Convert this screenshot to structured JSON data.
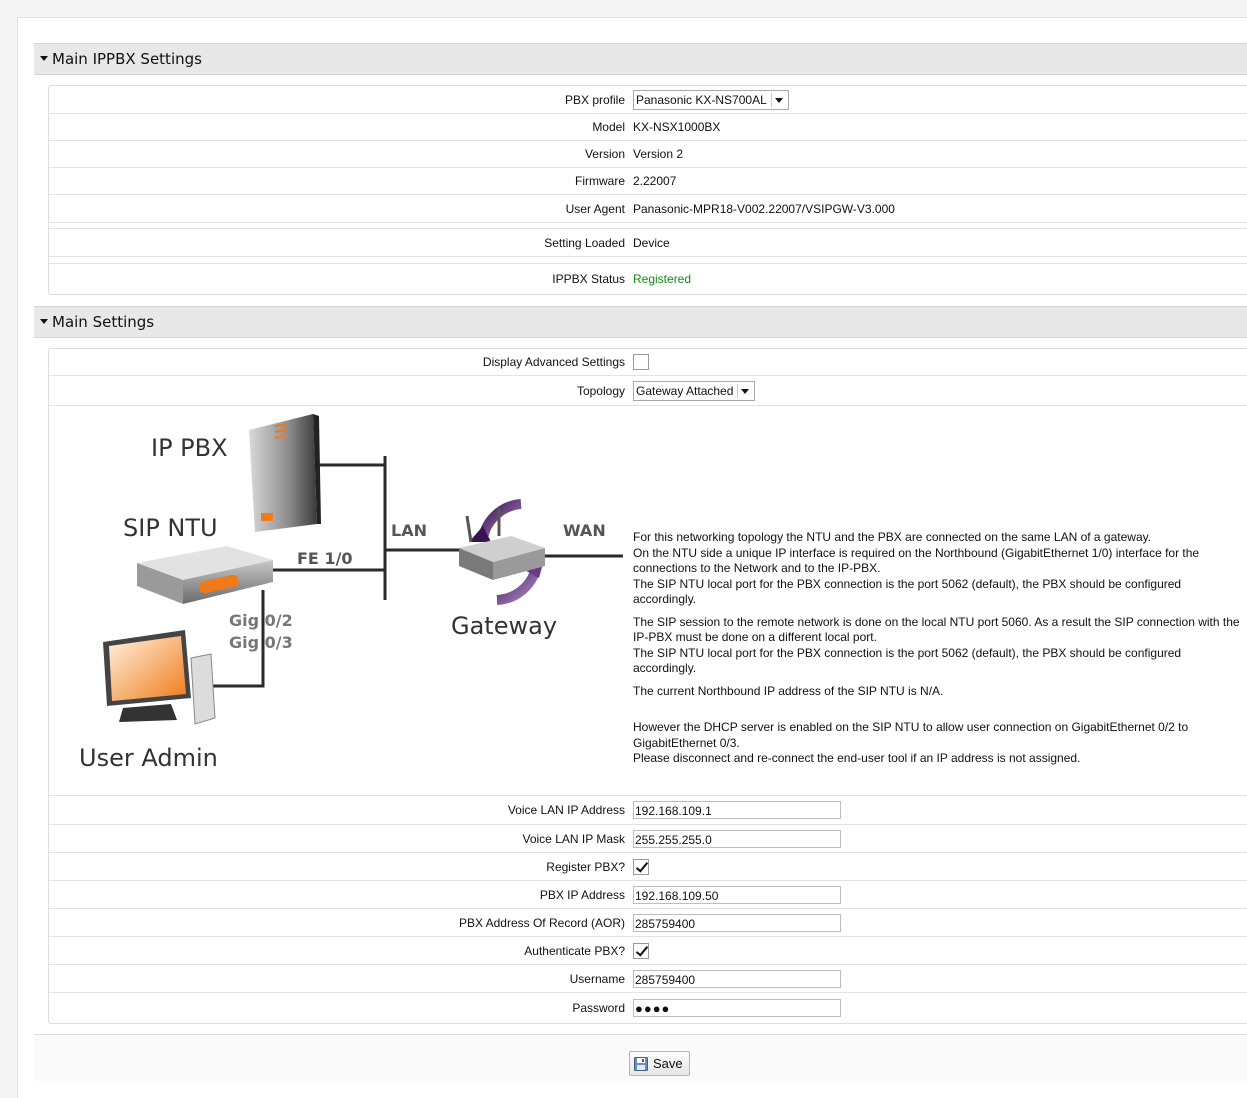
{
  "sections": {
    "ippbx_title": "Main IPPBX Settings",
    "main_title": "Main Settings"
  },
  "ippbx": {
    "pbx_profile": {
      "label": "PBX profile",
      "value": "Panasonic KX-NS700AL"
    },
    "model": {
      "label": "Model",
      "value": "KX-NSX1000BX"
    },
    "version": {
      "label": "Version",
      "value": "Version 2"
    },
    "firmware": {
      "label": "Firmware",
      "value": "2.22007"
    },
    "user_agent": {
      "label": "User Agent",
      "value": "Panasonic-MPR18-V002.22007/VSIPGW-V3.000"
    },
    "setting_loaded": {
      "label": "Setting Loaded",
      "value": "Device"
    },
    "status": {
      "label": "IPPBX Status",
      "value": "Registered",
      "color": "#128a12"
    }
  },
  "main": {
    "display_advanced": {
      "label": "Display Advanced Settings",
      "checked": false
    },
    "topology": {
      "label": "Topology",
      "value": "Gateway Attached"
    },
    "diagram": {
      "ip_pbx": "IP PBX",
      "sip_ntu": "SIP NTU",
      "lan": "LAN",
      "wan": "WAN",
      "fe": "FE 1/0",
      "gig2": "Gig 0/2",
      "gig3": "Gig 0/3",
      "gateway": "Gateway",
      "user_admin": "User Admin"
    },
    "description": [
      "For this networking topology the NTU and the PBX are connected on the same LAN of a gateway.\nOn the NTU side a unique IP interface is required on the Northbound (GigabitEthernet 1/0) interface for the connections to the Network and to the IP-PBX.\nThe SIP NTU local port for the PBX connection is the port 5062 (default), the PBX should be configured accordingly.",
      "The SIP session to the remote network is done on the local NTU port 5060. As a result the SIP connection with the IP-PBX must be done on a different local port.\nThe SIP NTU local port for the PBX connection is the port 5062 (default), the PBX should be configured accordingly.",
      "The current Northbound IP address of the SIP NTU is N/A.",
      "However the DHCP server is enabled on the SIP NTU to allow user connection on GigabitEthernet 0/2 to GigabitEthernet 0/3.\nPlease disconnect and re-connect the end-user tool if an IP address is not assigned."
    ],
    "voice_lan_ip": {
      "label": "Voice LAN IP Address",
      "value": "192.168.109.1"
    },
    "voice_lan_mask": {
      "label": "Voice LAN IP Mask",
      "value": "255.255.255.0"
    },
    "register_pbx": {
      "label": "Register PBX?",
      "checked": true
    },
    "pbx_ip": {
      "label": "PBX IP Address",
      "value": "192.168.109.50"
    },
    "pbx_aor": {
      "label": "PBX Address Of Record (AOR)",
      "value": "285759400"
    },
    "authenticate_pbx": {
      "label": "Authenticate PBX?",
      "checked": true
    },
    "username": {
      "label": "Username",
      "value": "285759400"
    },
    "password": {
      "label": "Password",
      "value": "●●●●"
    }
  },
  "save_label": "Save",
  "colors": {
    "header_bg": "#e8e8e8",
    "status_green": "#128a12",
    "orange": "#f07a1a",
    "purple": "#5b2a7a"
  }
}
